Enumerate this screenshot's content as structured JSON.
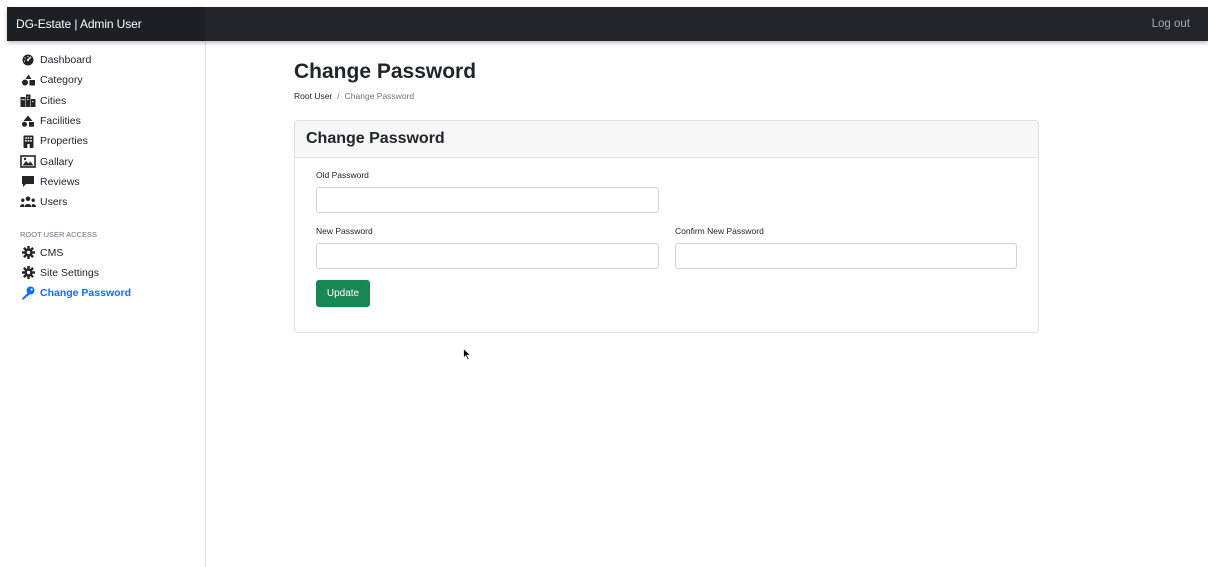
{
  "navbar": {
    "brand": "DG-Estate | Admin User",
    "logout_label": "Log out"
  },
  "sidebar": {
    "items": [
      {
        "label": "Dashboard",
        "icon": "dashboard-gauge-icon"
      },
      {
        "label": "Category",
        "icon": "category-shapes-icon"
      },
      {
        "label": "Cities",
        "icon": "city-icon"
      },
      {
        "label": "Facilities",
        "icon": "facilities-icon"
      },
      {
        "label": "Properties",
        "icon": "building-icon"
      },
      {
        "label": "Gallary",
        "icon": "image-icon"
      },
      {
        "label": "Reviews",
        "icon": "comment-icon"
      },
      {
        "label": "Users",
        "icon": "users-icon"
      }
    ],
    "section_heading": "ROOT USER ACCESS",
    "root_items": [
      {
        "label": "CMS",
        "icon": "gear-icon"
      },
      {
        "label": "Site Settings",
        "icon": "gear-icon"
      },
      {
        "label": "Change Password",
        "icon": "key-icon",
        "active": true
      }
    ]
  },
  "main": {
    "title": "Change Password",
    "breadcrumb": {
      "root": "Root User",
      "separator": "/",
      "current": "Change Password"
    },
    "card": {
      "header": "Change Password",
      "old_password_label": "Old Password",
      "old_password_value": "",
      "new_password_label": "New Password",
      "new_password_value": "",
      "confirm_password_label": "Confirm New Password",
      "confirm_password_value": "",
      "update_label": "Update"
    }
  },
  "colors": {
    "navbar_bg": "#212529",
    "active_link": "#0d6efd",
    "update_button": "#198754"
  }
}
